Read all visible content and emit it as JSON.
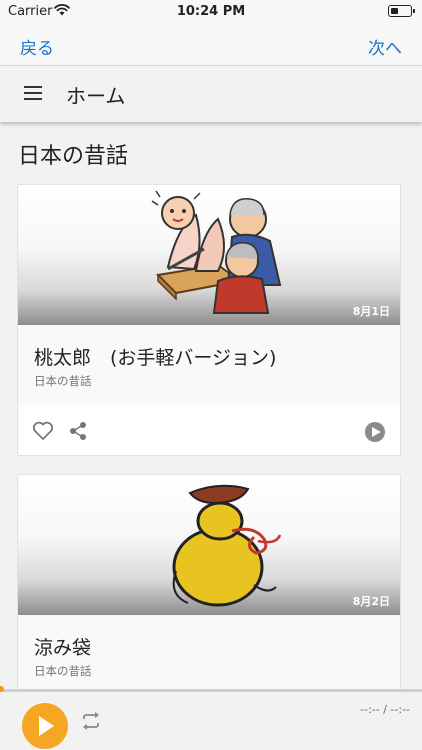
{
  "status_bar": {
    "carrier": "Carrier",
    "time": "10:24 PM",
    "icons": [
      "wifi-icon",
      "battery-icon"
    ]
  },
  "nav": {
    "back_label": "戻る",
    "next_label": "次へ"
  },
  "header": {
    "title": "ホーム",
    "menu_icon": "hamburger-icon"
  },
  "section": {
    "title": "日本の昔話"
  },
  "cards": [
    {
      "title": "桃太郎　(お手軽バージョン)",
      "category": "日本の昔話",
      "date": "8月1日",
      "image": "momotaro-illustration"
    },
    {
      "title": "涼み袋",
      "category": "日本の昔話",
      "date": "8月2日",
      "image": "gourd-illustration"
    }
  ],
  "card_actions": {
    "icons": [
      "heart-icon",
      "share-icon",
      "play-circle-icon"
    ]
  },
  "player": {
    "time_display": "--:-- / --:--",
    "progress": 0,
    "icons": [
      "play-icon",
      "repeat-icon"
    ]
  },
  "colors": {
    "accent": "#f5a623",
    "link": "#1a73c9",
    "background": "#f2f2f2"
  }
}
